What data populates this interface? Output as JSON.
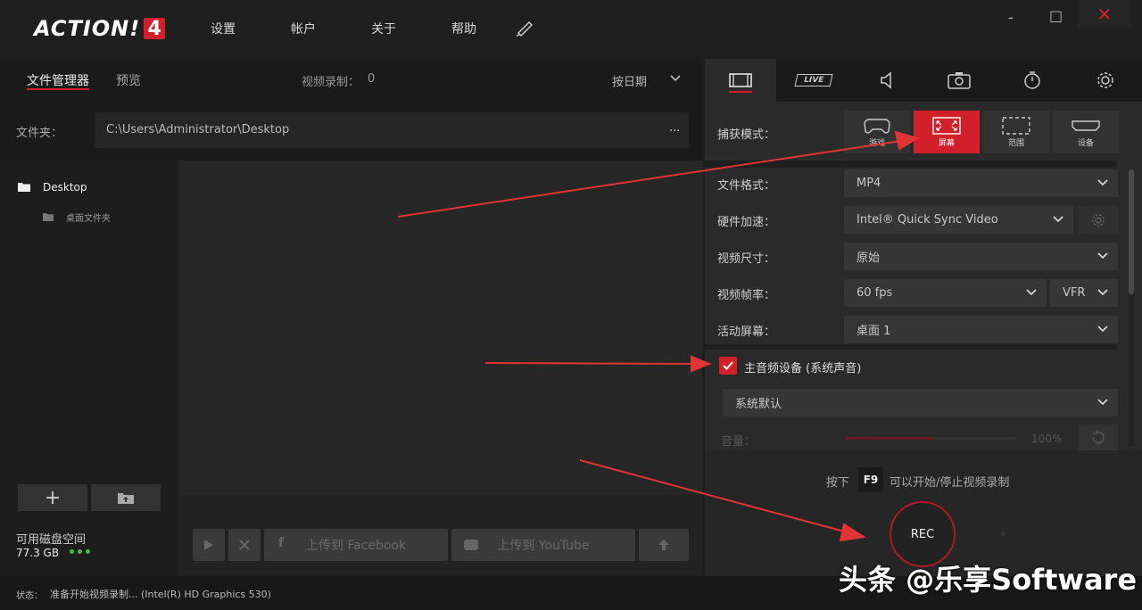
{
  "app": {
    "logo_text": "ACTION!",
    "logo_num": "4"
  },
  "menu": [
    "设置",
    "帐户",
    "关于",
    "帮助"
  ],
  "window": {
    "minimize": "-",
    "maximize": "□",
    "close": "✕"
  },
  "left": {
    "tabs": [
      "文件管理器",
      "预览"
    ],
    "recordings_label": "视频录制：",
    "recordings_count": "0",
    "sort_label": "按日期",
    "folder_label": "文件夹：",
    "folder_path": "C:\\Users\\Administrator\\Desktop",
    "folder_more": "...",
    "tree": [
      {
        "label": "Desktop"
      },
      {
        "label": "桌面文件夹"
      }
    ],
    "disk_label": "可用磁盘空间",
    "disk_value": "77.3  GB",
    "upload_facebook": "上传到 Facebook",
    "upload_youtube": "上传到 YouTube"
  },
  "right": {
    "tabs": [
      {
        "icon": "film-icon"
      },
      {
        "icon": "live-icon",
        "label": "LIVE"
      },
      {
        "icon": "speaker-icon"
      },
      {
        "icon": "camera-icon"
      },
      {
        "icon": "timer-icon"
      },
      {
        "icon": "gear-icon"
      }
    ],
    "capture_mode_label": "捕获模式：",
    "modes": [
      {
        "label": "游戏",
        "icon": "gamepad-icon"
      },
      {
        "label": "屏幕",
        "icon": "fullscreen-icon",
        "active": true
      },
      {
        "label": "范围",
        "icon": "region-icon"
      },
      {
        "label": "设备",
        "icon": "hdmi-icon"
      }
    ],
    "file_format_label": "文件格式：",
    "file_format": "MP4",
    "hw_accel_label": "硬件加速：",
    "hw_accel": "Intel® Quick Sync Video",
    "video_size_label": "视频尺寸：",
    "video_size": "原始",
    "framerate_label": "视频帧率：",
    "framerate": "60 fps",
    "framerate_mode": "VFR",
    "active_screen_label": "活动屏幕：",
    "active_screen": "桌面 1",
    "audio_device_label": "主音频设备 (系统声音)",
    "audio_device_checked": true,
    "audio_device": "系统默认",
    "volume_label": "音量：",
    "volume_value": "100%",
    "hotkey_prefix": "按下",
    "hotkey_key": "F9",
    "hotkey_suffix": "可以开始/停止视频录制",
    "rec_label": "REC"
  },
  "status": {
    "label": "状态：",
    "text": "准备开始视频录制...  (Intel(R) HD Graphics 530)"
  },
  "watermark": "头条 @乐享Software",
  "colors": {
    "accent": "#d2202a",
    "arrow": "#e23434"
  }
}
